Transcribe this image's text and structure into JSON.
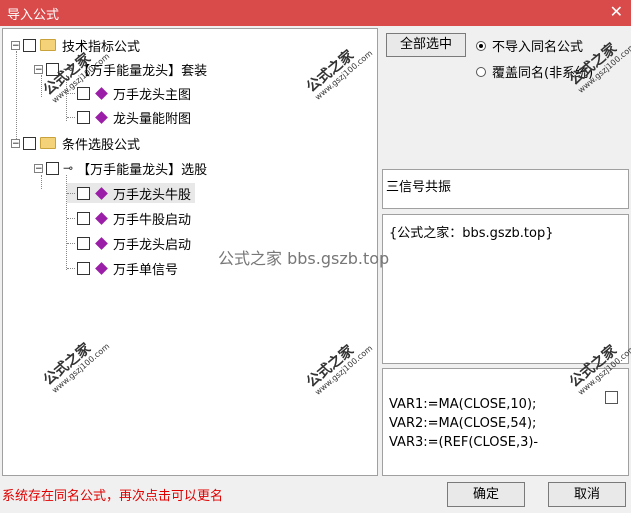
{
  "window": {
    "title": "导入公式",
    "close_glyph": "✕"
  },
  "tree": {
    "groups": [
      {
        "label": "技术指标公式",
        "sub": {
          "label": "【万手能量龙头】套装"
        },
        "items": [
          "万手龙头主图",
          "龙头量能附图"
        ]
      },
      {
        "label": "条件选股公式",
        "sub": {
          "label": "【万手能量龙头】选股"
        },
        "items": [
          "万手龙头牛股",
          "万手牛股启动",
          "万手龙头启动",
          "万手单信号"
        ]
      }
    ]
  },
  "buttons": {
    "select_all": "全部选中",
    "ok": "确定",
    "cancel": "取消"
  },
  "options": {
    "no_import": "不导入同名公式",
    "overwrite": "覆盖同名(非系统)",
    "selected": "no_import"
  },
  "info": {
    "name": "三信号共振",
    "description": "{公式之家：bbs.gszb.top}"
  },
  "code_lines": [
    "VAR1:=MA(CLOSE,10);",
    "VAR2:=MA(CLOSE,54);",
    "VAR3:=(REF(CLOSE,3)-"
  ],
  "status_note": "系统存在同名公式，再次点击可以更名",
  "watermark": {
    "main": "公式之家",
    "url": "www.gszj100.com",
    "center": "公式之家 bbs.gszb.top"
  },
  "colors": {
    "titlebar": "#d94a4a",
    "note": "#e00000",
    "item_icon": "#9a1ea8"
  }
}
